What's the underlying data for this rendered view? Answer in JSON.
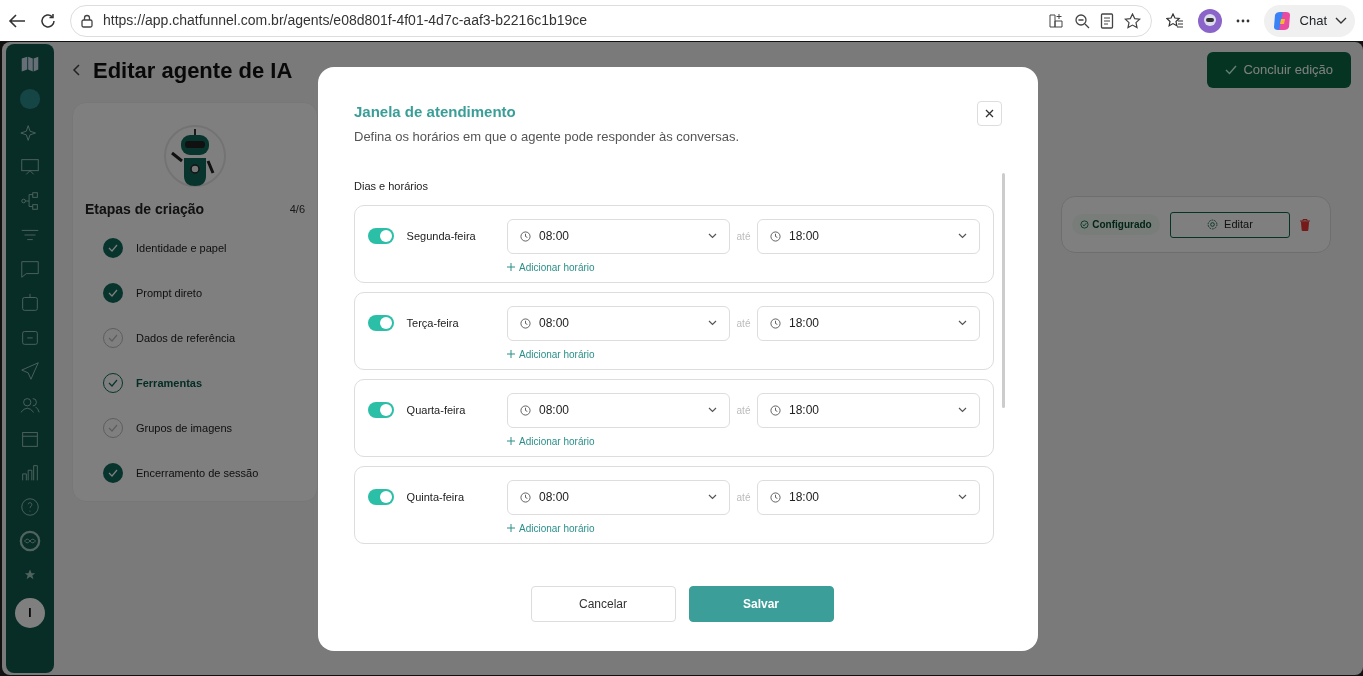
{
  "browser": {
    "url": "https://app.chatfunnel.com.br/agents/e08d801f-4f01-4d7c-aaf3-b2216c1b19ce",
    "chat_label": "Chat"
  },
  "sidebar": {
    "avatar_initial": "I"
  },
  "page": {
    "title": "Editar agente de IA",
    "primary_action": "Concluir edição"
  },
  "steps_card": {
    "title": "Etapas de criação",
    "count": "4/6",
    "steps": [
      {
        "label": "Identidade e papel",
        "completed": true,
        "selected": false
      },
      {
        "label": "Prompt direto",
        "completed": true,
        "selected": false
      },
      {
        "label": "Dados de referência",
        "completed": false,
        "selected": false
      },
      {
        "label": "Ferramentas",
        "completed": false,
        "selected": true
      },
      {
        "label": "Grupos de imagens",
        "completed": false,
        "selected": false
      },
      {
        "label": "Encerramento de sessão",
        "completed": true,
        "selected": false
      }
    ]
  },
  "tool_row": {
    "badge": "Configurado",
    "edit_button": "Editar"
  },
  "modal": {
    "title": "Janela de atendimento",
    "subtitle": "Defina os horários em que o agente pode responder às conversas.",
    "section_label": "Dias e horários",
    "days": [
      {
        "name": "Segunda-feira",
        "on": true,
        "start": "08:00",
        "separator": "até",
        "end": "18:00",
        "add_label": "Adicionar horário"
      },
      {
        "name": "Terça-feira",
        "on": true,
        "start": "08:00",
        "separator": "até",
        "end": "18:00",
        "add_label": "Adicionar horário"
      },
      {
        "name": "Quarta-feira",
        "on": true,
        "start": "08:00",
        "separator": "até",
        "end": "18:00",
        "add_label": "Adicionar horário"
      },
      {
        "name": "Quinta-feira",
        "on": true,
        "start": "08:00",
        "separator": "até",
        "end": "18:00",
        "add_label": "Adicionar horário"
      }
    ],
    "cancel": "Cancelar",
    "save": "Salvar"
  }
}
